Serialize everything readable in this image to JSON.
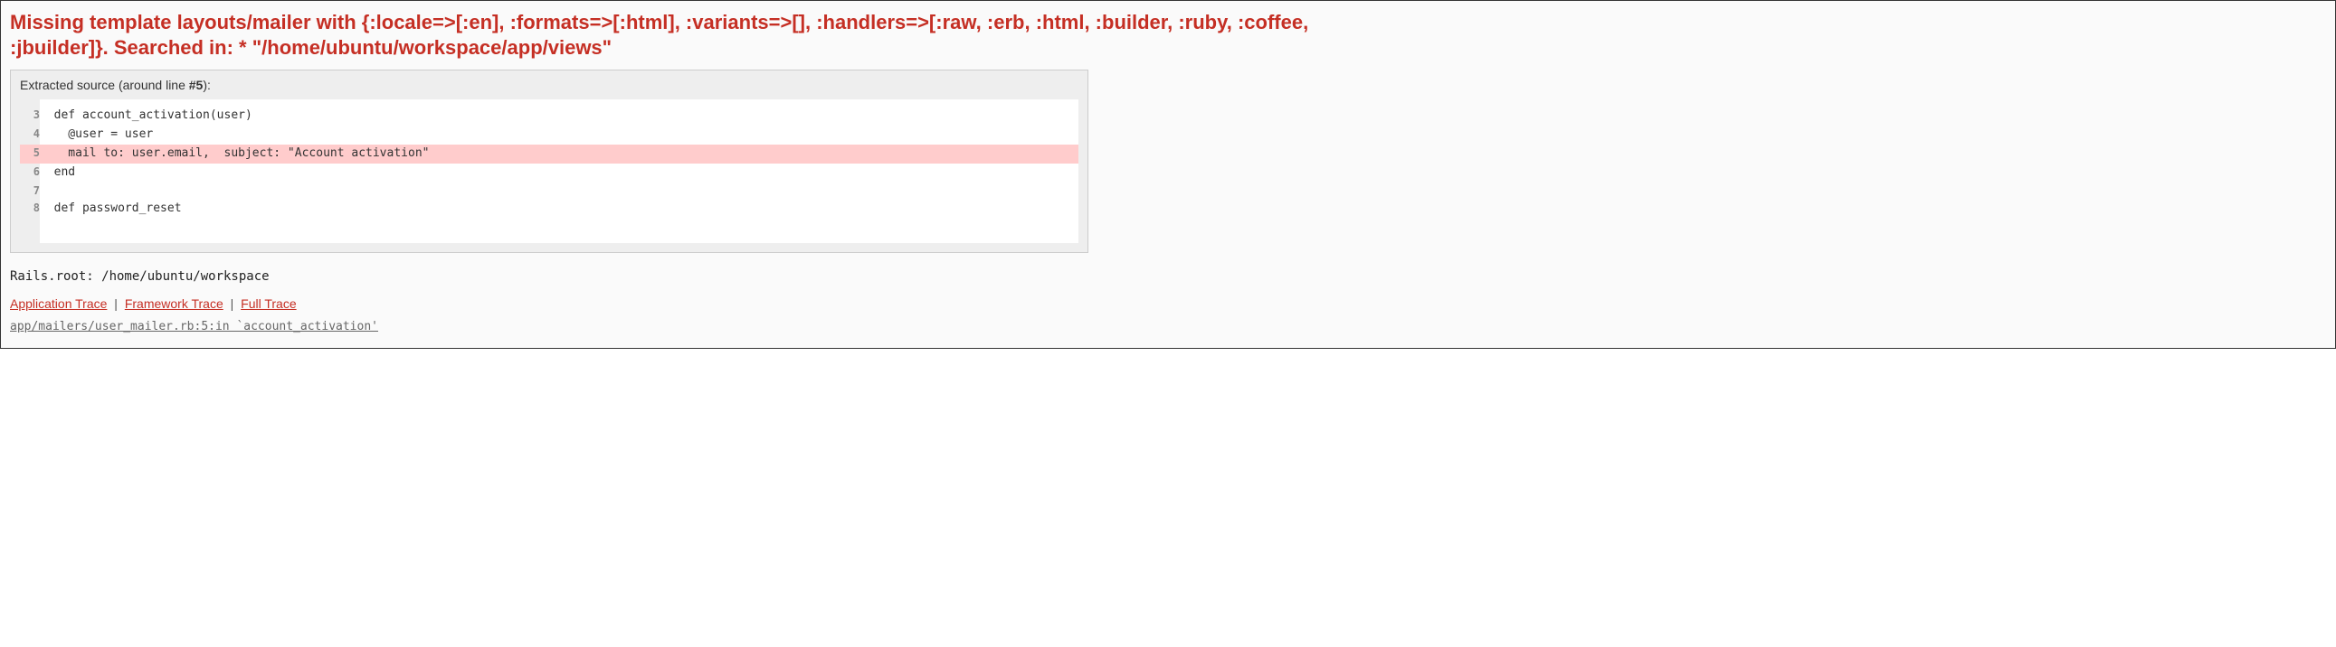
{
  "error": {
    "title": "Missing template layouts/mailer with {:locale=>[:en], :formats=>[:html], :variants=>[], :handlers=>[:raw, :erb, :html, :builder, :ruby, :coffee, :jbuilder]}. Searched in: * \"/home/ubuntu/workspace/app/views\""
  },
  "source": {
    "label_prefix": "Extracted source (around line ",
    "label_line": "#5",
    "label_suffix": "):",
    "highlight_line": 5,
    "lines": [
      {
        "n": 3,
        "code": "  def account_activation(user)"
      },
      {
        "n": 4,
        "code": "    @user = user"
      },
      {
        "n": 5,
        "code": "    mail to: user.email,  subject: \"Account activation\""
      },
      {
        "n": 6,
        "code": "  end"
      },
      {
        "n": 7,
        "code": ""
      },
      {
        "n": 8,
        "code": "  def password_reset"
      }
    ]
  },
  "rails_root": "Rails.root: /home/ubuntu/workspace",
  "traces": {
    "tabs": {
      "application": "Application Trace",
      "framework": "Framework Trace",
      "full": "Full Trace"
    },
    "separator": "|",
    "application_lines": [
      "app/mailers/user_mailer.rb:5:in `account_activation'"
    ]
  },
  "colors": {
    "rails_red": "#C52F24",
    "highlight_bg": "#FFCCCC"
  }
}
